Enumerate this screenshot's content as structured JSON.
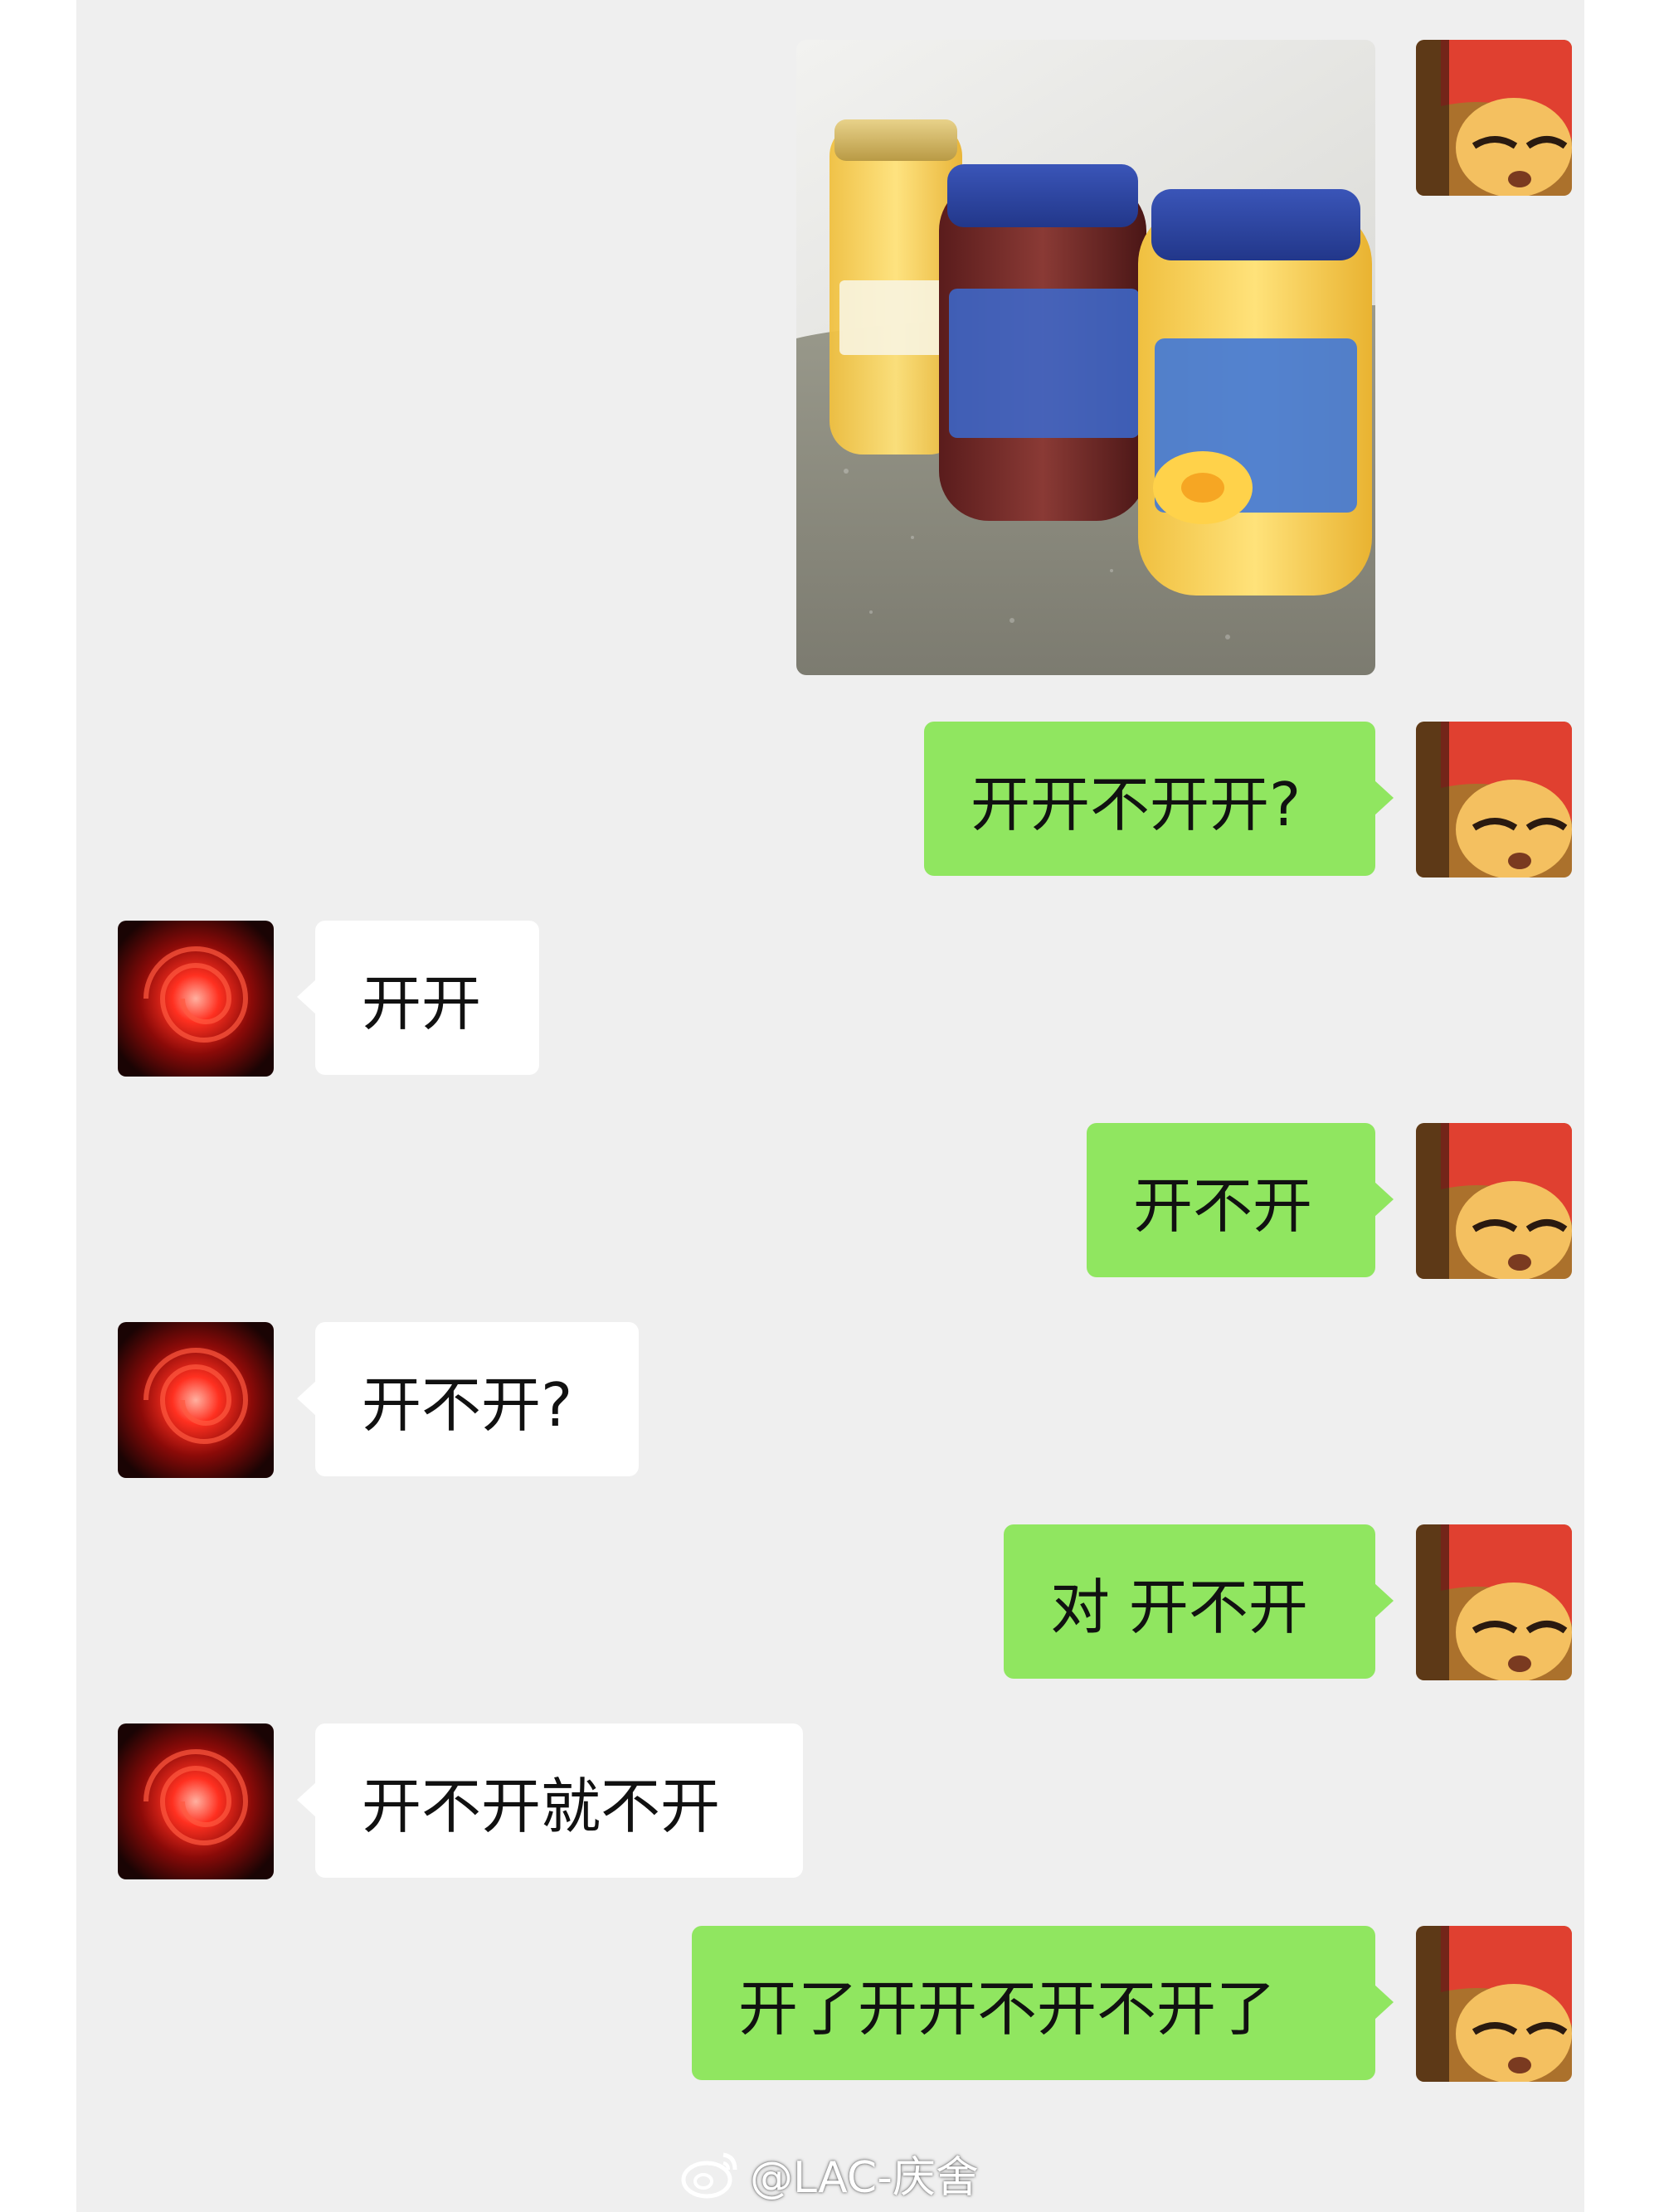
{
  "colors": {
    "background": "#efefef",
    "outgoing_bubble": "#90e660",
    "incoming_bubble": "#ffffff",
    "text": "#111111"
  },
  "messages": [
    {
      "direction": "out",
      "type": "image",
      "image_icon": "canned-fruit-jars-photo"
    },
    {
      "direction": "out",
      "type": "text",
      "text": "开开不开开?"
    },
    {
      "direction": "in",
      "type": "text",
      "text": "开开"
    },
    {
      "direction": "out",
      "type": "text",
      "text": "开不开"
    },
    {
      "direction": "in",
      "type": "text",
      "text": "开不开?"
    },
    {
      "direction": "out",
      "type": "text",
      "text": "对 开不开"
    },
    {
      "direction": "in",
      "type": "text",
      "text": "开不开就不开"
    },
    {
      "direction": "out",
      "type": "text",
      "text": "开了开开不开不开了"
    }
  ],
  "watermark": {
    "icon": "weibo-logo-icon",
    "text": "@LAC-庆舍"
  }
}
